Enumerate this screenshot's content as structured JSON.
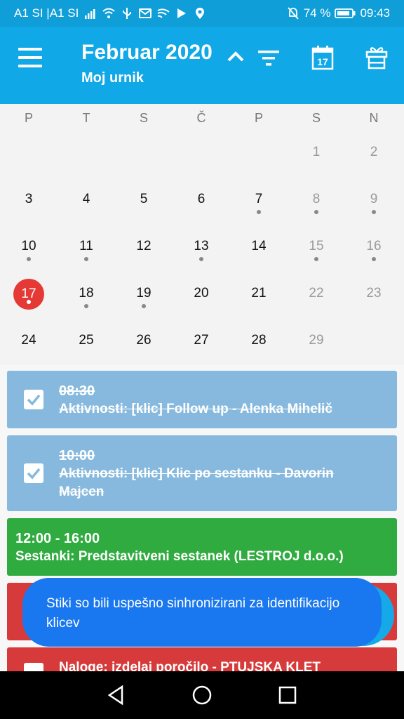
{
  "status_bar": {
    "carrier": "A1 SI |A1 SI",
    "battery": "74 %",
    "time": "09:43"
  },
  "app_bar": {
    "title": "Februar 2020",
    "subtitle": "Moj urnik",
    "calendar_icon_day": "17"
  },
  "calendar": {
    "weekdays": [
      "P",
      "T",
      "S",
      "Č",
      "P",
      "S",
      "N"
    ],
    "weeks": [
      [
        {
          "d": ""
        },
        {
          "d": ""
        },
        {
          "d": ""
        },
        {
          "d": ""
        },
        {
          "d": ""
        },
        {
          "d": "1",
          "muted": true
        },
        {
          "d": "2",
          "muted": true
        }
      ],
      [
        {
          "d": "3"
        },
        {
          "d": "4"
        },
        {
          "d": "5"
        },
        {
          "d": "6"
        },
        {
          "d": "7",
          "dot": true
        },
        {
          "d": "8",
          "muted": true,
          "dot": true
        },
        {
          "d": "9",
          "muted": true,
          "dot": true
        }
      ],
      [
        {
          "d": "10",
          "dot": true
        },
        {
          "d": "11",
          "dot": true
        },
        {
          "d": "12"
        },
        {
          "d": "13",
          "dot": true
        },
        {
          "d": "14"
        },
        {
          "d": "15",
          "muted": true,
          "dot": true
        },
        {
          "d": "16",
          "muted": true,
          "dot": true
        }
      ],
      [
        {
          "d": "17",
          "today": true,
          "dot": true
        },
        {
          "d": "18",
          "dot": true
        },
        {
          "d": "19",
          "dot": true
        },
        {
          "d": "20"
        },
        {
          "d": "21"
        },
        {
          "d": "22",
          "muted": true
        },
        {
          "d": "23",
          "muted": true
        }
      ],
      [
        {
          "d": "24"
        },
        {
          "d": "25"
        },
        {
          "d": "26"
        },
        {
          "d": "27"
        },
        {
          "d": "28"
        },
        {
          "d": "29",
          "muted": true
        },
        {
          "d": ""
        }
      ]
    ]
  },
  "events": [
    {
      "time": "08:30",
      "text": "Aktivnosti: [klic] Follow up - Alenka Mihelič",
      "color": "blue",
      "done": true
    },
    {
      "time": "10:00",
      "text": "Aktivnosti: [klic] Klic po sestanku - Davorin Majcen",
      "color": "blue",
      "done": true
    },
    {
      "time": "12:00 - 16:00",
      "text": "Sestanki: Predstavitveni sestanek (LESTROJ d.o.o.)",
      "color": "green",
      "done": false
    },
    {
      "time": "",
      "text": "Naloge: izdelaj poročilo - PTUJSKA KLET",
      "color": "red",
      "done": false
    }
  ],
  "toast": {
    "message": "Stiki so bili uspešno sinhronizirani za identifikacijo klicev"
  },
  "colors": {
    "status_bar": "#0f9ed8",
    "app_bar": "#10a8e6",
    "today": "#e53935",
    "event_done": "#86b9dd",
    "event_meeting": "#2fab3f",
    "event_task": "#d73a3a",
    "toast": "#1977ef"
  }
}
